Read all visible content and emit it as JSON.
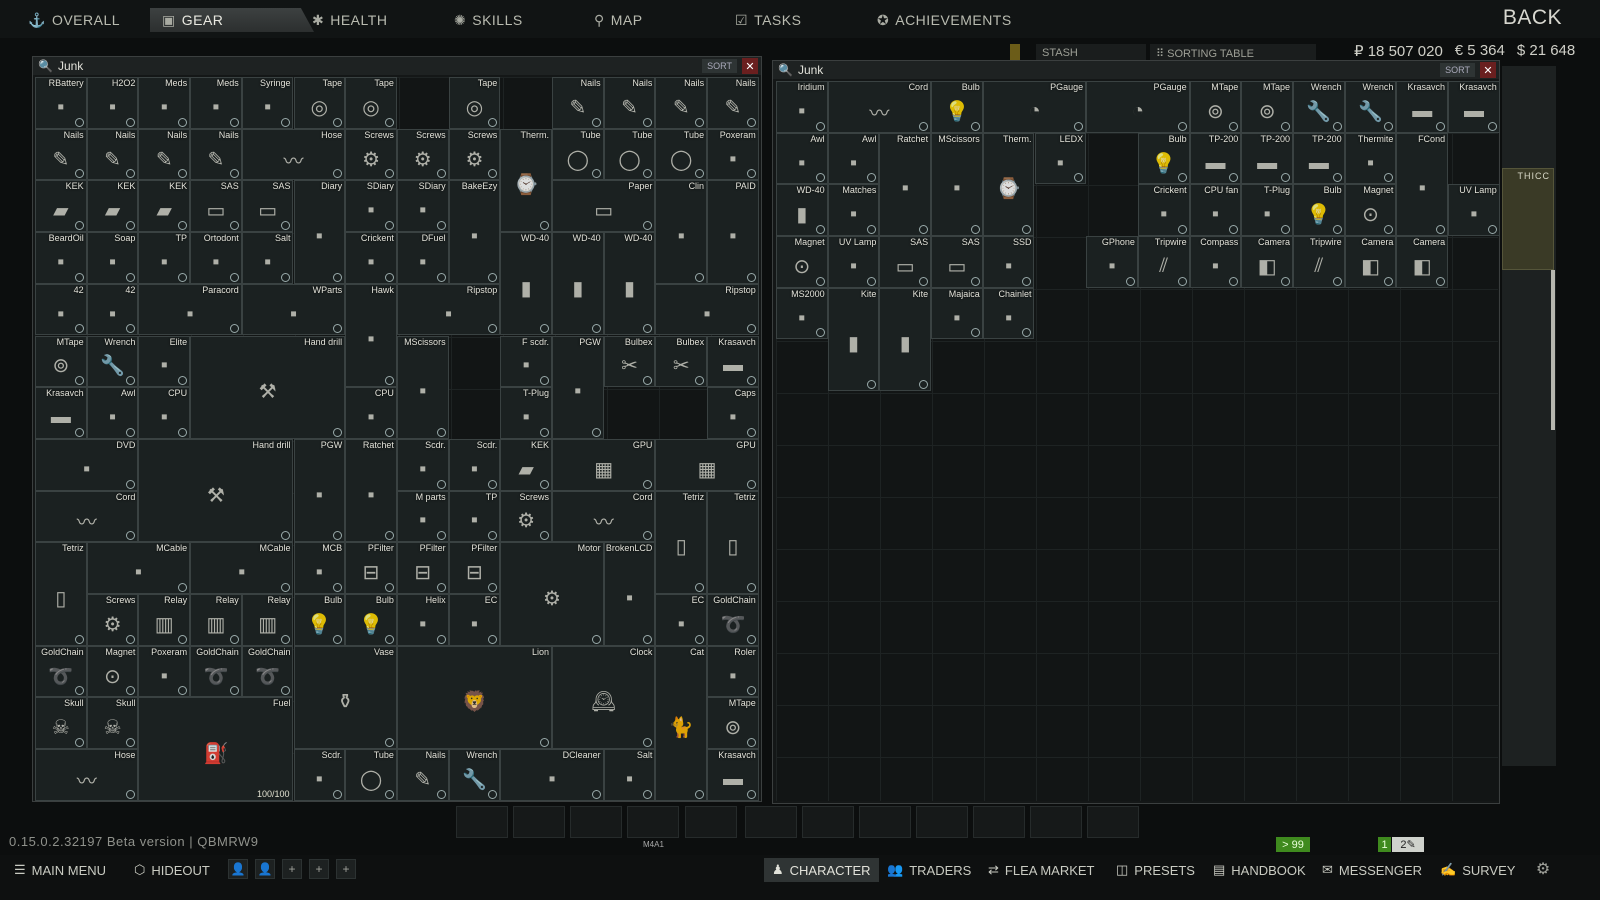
{
  "nav": {
    "tabs": [
      {
        "label": "OVERALL",
        "icon": "person-icon"
      },
      {
        "label": "GEAR",
        "icon": "vest-icon"
      },
      {
        "label": "HEALTH",
        "icon": "health-icon"
      },
      {
        "label": "SKILLS",
        "icon": "skills-icon"
      },
      {
        "label": "MAP",
        "icon": "map-pin-icon"
      },
      {
        "label": "TASKS",
        "icon": "tasks-icon"
      },
      {
        "label": "ACHIEVEMENTS",
        "icon": "achievement-icon"
      }
    ],
    "active_tab": "GEAR",
    "back_label": "BACK"
  },
  "stash_header": {
    "stash_label": "STASH",
    "sorting_table_label": "SORTING TABLE",
    "roubles": "₽ 18 507 020",
    "euros": "€ 5 364",
    "dollars": "$ 21 648"
  },
  "left_window": {
    "title": "Junk",
    "sort_label": "SORT",
    "close_label": "✕",
    "items": [
      [
        "RBattery",
        0,
        0,
        1,
        1
      ],
      [
        "H2O2",
        1,
        0,
        1,
        1
      ],
      [
        "Meds",
        2,
        0,
        1,
        1
      ],
      [
        "Meds",
        3,
        0,
        1,
        1
      ],
      [
        "Syringe",
        4,
        0,
        1,
        1
      ],
      [
        "Tape",
        5,
        0,
        1,
        1
      ],
      [
        "Tape",
        6,
        0,
        1,
        1
      ],
      [
        "Tape",
        8,
        0,
        1,
        1
      ],
      [
        "Nails",
        10,
        0,
        1,
        1
      ],
      [
        "Nails",
        11,
        0,
        1,
        1
      ],
      [
        "Nails",
        12,
        0,
        1,
        1
      ],
      [
        "Nails",
        13,
        0,
        1,
        1
      ],
      [
        "Nails",
        0,
        1,
        1,
        1
      ],
      [
        "Nails",
        1,
        1,
        1,
        1
      ],
      [
        "Nails",
        2,
        1,
        1,
        1
      ],
      [
        "Nails",
        3,
        1,
        1,
        1
      ],
      [
        "Hose",
        4,
        1,
        2,
        1
      ],
      [
        "Screws",
        6,
        1,
        1,
        1
      ],
      [
        "Screws",
        7,
        1,
        1,
        1
      ],
      [
        "Screws",
        8,
        1,
        1,
        1
      ],
      [
        "Therm.",
        9,
        1,
        1,
        2
      ],
      [
        "Tube",
        10,
        1,
        1,
        1
      ],
      [
        "Tube",
        11,
        1,
        1,
        1
      ],
      [
        "Tube",
        12,
        1,
        1,
        1
      ],
      [
        "Poxeram",
        13,
        1,
        1,
        1
      ],
      [
        "KEK",
        0,
        2,
        1,
        1
      ],
      [
        "KEK",
        1,
        2,
        1,
        1
      ],
      [
        "KEK",
        2,
        2,
        1,
        1
      ],
      [
        "SAS",
        3,
        2,
        1,
        1
      ],
      [
        "SAS",
        4,
        2,
        1,
        1
      ],
      [
        "Diary",
        5,
        2,
        1,
        2
      ],
      [
        "SDiary",
        6,
        2,
        1,
        1
      ],
      [
        "SDiary",
        7,
        2,
        1,
        1
      ],
      [
        "BakeEzy",
        8,
        2,
        1,
        2
      ],
      [
        "Paper",
        10,
        2,
        2,
        1
      ],
      [
        "Clin",
        12,
        2,
        1,
        2
      ],
      [
        "PAID",
        13,
        2,
        1,
        2
      ],
      [
        "BeardOil",
        0,
        3,
        1,
        1
      ],
      [
        "Soap",
        1,
        3,
        1,
        1
      ],
      [
        "TP",
        2,
        3,
        1,
        1
      ],
      [
        "Ortodont",
        3,
        3,
        1,
        1
      ],
      [
        "Salt",
        4,
        3,
        1,
        1
      ],
      [
        "Crickent",
        6,
        3,
        1,
        1
      ],
      [
        "DFuel",
        7,
        3,
        1,
        1
      ],
      [
        "WD-40",
        9,
        3,
        1,
        2
      ],
      [
        "WD-40",
        10,
        3,
        1,
        2
      ],
      [
        "WD-40",
        11,
        3,
        1,
        2
      ],
      [
        "42",
        0,
        4,
        1,
        1
      ],
      [
        "42",
        1,
        4,
        1,
        1
      ],
      [
        "Paracord",
        2,
        4,
        2,
        1
      ],
      [
        "WParts",
        4,
        4,
        2,
        1
      ],
      [
        "Hawk",
        6,
        4,
        1,
        2
      ],
      [
        "Ripstop",
        7,
        4,
        2,
        1
      ],
      [
        "Ripstop",
        12,
        4,
        2,
        1
      ],
      [
        "MTape",
        0,
        5,
        1,
        1
      ],
      [
        "Wrench",
        1,
        5,
        1,
        1
      ],
      [
        "Elite",
        2,
        5,
        1,
        1
      ],
      [
        "Hand drill",
        3,
        5,
        3,
        2
      ],
      [
        "MScissors",
        7,
        5,
        1,
        2
      ],
      [
        "F scdr.",
        9,
        5,
        1,
        1
      ],
      [
        "PGW",
        10,
        5,
        1,
        2
      ],
      [
        "Bulbex",
        11,
        5,
        1,
        1
      ],
      [
        "Bulbex",
        12,
        5,
        1,
        1
      ],
      [
        "Krasavch",
        13,
        5,
        1,
        1
      ],
      [
        "Krasavch",
        0,
        6,
        1,
        1
      ],
      [
        "Awl",
        1,
        6,
        1,
        1
      ],
      [
        "CPU",
        2,
        6,
        1,
        1
      ],
      [
        "CPU",
        6,
        6,
        1,
        1
      ],
      [
        "T-Plug",
        9,
        6,
        1,
        1
      ],
      [
        "Caps",
        13,
        6,
        1,
        1
      ],
      [
        "DVD",
        0,
        7,
        2,
        1
      ],
      [
        "Hand drill",
        2,
        7,
        3,
        2
      ],
      [
        "PGW",
        5,
        7,
        1,
        2
      ],
      [
        "Ratchet",
        6,
        7,
        1,
        2
      ],
      [
        "Scdr.",
        7,
        7,
        1,
        1
      ],
      [
        "Scdr.",
        8,
        7,
        1,
        1
      ],
      [
        "KEK",
        9,
        7,
        1,
        1
      ],
      [
        "GPU",
        10,
        7,
        2,
        1
      ],
      [
        "GPU",
        12,
        7,
        2,
        1
      ],
      [
        "Cord",
        0,
        8,
        2,
        1
      ],
      [
        "M parts",
        7,
        8,
        1,
        1
      ],
      [
        "TP",
        8,
        8,
        1,
        1
      ],
      [
        "Screws",
        9,
        8,
        1,
        1
      ],
      [
        "Cord",
        10,
        8,
        2,
        1
      ],
      [
        "Tetriz",
        12,
        8,
        1,
        2
      ],
      [
        "Tetriz",
        13,
        8,
        1,
        2
      ],
      [
        "Tetriz",
        0,
        9,
        1,
        2
      ],
      [
        "MCable",
        1,
        9,
        2,
        1
      ],
      [
        "MCable",
        3,
        9,
        2,
        1
      ],
      [
        "MCB",
        5,
        9,
        1,
        1
      ],
      [
        "PFilter",
        6,
        9,
        1,
        1
      ],
      [
        "PFilter",
        7,
        9,
        1,
        1
      ],
      [
        "PFilter",
        8,
        9,
        1,
        1
      ],
      [
        "Motor",
        9,
        9,
        2,
        2
      ],
      [
        "BrokenLCD",
        11,
        9,
        1,
        2
      ],
      [
        "Screws",
        1,
        10,
        1,
        1
      ],
      [
        "Relay",
        2,
        10,
        1,
        1
      ],
      [
        "Relay",
        3,
        10,
        1,
        1
      ],
      [
        "Relay",
        4,
        10,
        1,
        1
      ],
      [
        "Bulb",
        5,
        10,
        1,
        1
      ],
      [
        "Bulb",
        6,
        10,
        1,
        1
      ],
      [
        "Helix",
        7,
        10,
        1,
        1
      ],
      [
        "EC",
        8,
        10,
        1,
        1
      ],
      [
        "EC",
        12,
        10,
        1,
        1
      ],
      [
        "GoldChain",
        13,
        10,
        1,
        1
      ],
      [
        "GoldChain",
        0,
        11,
        1,
        1
      ],
      [
        "Magnet",
        1,
        11,
        1,
        1
      ],
      [
        "Poxeram",
        2,
        11,
        1,
        1
      ],
      [
        "GoldChain",
        3,
        11,
        1,
        1
      ],
      [
        "GoldChain",
        4,
        11,
        1,
        1
      ],
      [
        "Vase",
        5,
        11,
        2,
        2
      ],
      [
        "Lion",
        7,
        11,
        3,
        2
      ],
      [
        "Clock",
        10,
        11,
        2,
        2
      ],
      [
        "Cat",
        12,
        11,
        1,
        3
      ],
      [
        "Roler",
        13,
        11,
        1,
        1
      ],
      [
        "Skull",
        0,
        12,
        1,
        1
      ],
      [
        "Skull",
        1,
        12,
        1,
        1
      ],
      [
        "Fuel",
        2,
        12,
        3,
        2
      ],
      [
        "MTape",
        13,
        12,
        1,
        1
      ],
      [
        "Hose",
        0,
        13,
        2,
        1
      ],
      [
        "Scdr.",
        5,
        13,
        1,
        1
      ],
      [
        "Tube",
        6,
        13,
        1,
        1
      ],
      [
        "Nails",
        7,
        13,
        1,
        1
      ],
      [
        "Wrench",
        8,
        13,
        1,
        1
      ],
      [
        "DCleaner",
        9,
        13,
        2,
        1
      ],
      [
        "Salt",
        11,
        13,
        1,
        1
      ],
      [
        "Krasavch",
        13,
        13,
        1,
        1
      ]
    ],
    "fuel_durability": "100/100"
  },
  "right_window": {
    "title": "Junk",
    "sort_label": "SORT",
    "close_label": "✕",
    "items": [
      [
        "Iridium",
        0,
        0,
        1,
        1
      ],
      [
        "Cord",
        1,
        0,
        2,
        1
      ],
      [
        "Bulb",
        3,
        0,
        1,
        1
      ],
      [
        "PGauge",
        4,
        0,
        2,
        1
      ],
      [
        "PGauge",
        6,
        0,
        2,
        1
      ],
      [
        "MTape",
        8,
        0,
        1,
        1
      ],
      [
        "MTape",
        9,
        0,
        1,
        1
      ],
      [
        "Wrench",
        10,
        0,
        1,
        1
      ],
      [
        "Wrench",
        11,
        0,
        1,
        1
      ],
      [
        "Krasavch",
        12,
        0,
        1,
        1
      ],
      [
        "Krasavch",
        13,
        0,
        1,
        1
      ],
      [
        "Awl",
        0,
        1,
        1,
        1
      ],
      [
        "Awl",
        1,
        1,
        1,
        1
      ],
      [
        "Ratchet",
        2,
        1,
        1,
        2
      ],
      [
        "MScissors",
        3,
        1,
        1,
        2
      ],
      [
        "Therm.",
        4,
        1,
        1,
        2
      ],
      [
        "LEDX",
        5,
        1,
        1,
        1
      ],
      [
        "Bulb",
        7,
        1,
        1,
        1
      ],
      [
        "TP-200",
        8,
        1,
        1,
        1
      ],
      [
        "TP-200",
        9,
        1,
        1,
        1
      ],
      [
        "TP-200",
        10,
        1,
        1,
        1
      ],
      [
        "Thermite",
        11,
        1,
        1,
        1
      ],
      [
        "FCond",
        12,
        1,
        1,
        2
      ],
      [
        "WD-40",
        0,
        2,
        1,
        1
      ],
      [
        "Matches",
        1,
        2,
        1,
        1
      ],
      [
        "Crickent",
        7,
        2,
        1,
        1
      ],
      [
        "CPU fan",
        8,
        2,
        1,
        1
      ],
      [
        "T-Plug",
        9,
        2,
        1,
        1
      ],
      [
        "Bulb",
        10,
        2,
        1,
        1
      ],
      [
        "Magnet",
        11,
        2,
        1,
        1
      ],
      [
        "UV Lamp",
        13,
        2,
        1,
        1
      ],
      [
        "Magnet",
        0,
        3,
        1,
        1
      ],
      [
        "UV Lamp",
        1,
        3,
        1,
        1
      ],
      [
        "SAS",
        2,
        3,
        1,
        1
      ],
      [
        "SAS",
        3,
        3,
        1,
        1
      ],
      [
        "SSD",
        4,
        3,
        1,
        1
      ],
      [
        "GPhone",
        6,
        3,
        1,
        1
      ],
      [
        "Tripwire",
        7,
        3,
        1,
        1
      ],
      [
        "Compass",
        8,
        3,
        1,
        1
      ],
      [
        "Camera",
        9,
        3,
        1,
        1
      ],
      [
        "Tripwire",
        10,
        3,
        1,
        1
      ],
      [
        "Camera",
        11,
        3,
        1,
        1
      ],
      [
        "Camera",
        12,
        3,
        1,
        1
      ],
      [
        "MS2000",
        0,
        4,
        1,
        1
      ],
      [
        "Kite",
        1,
        4,
        1,
        2
      ],
      [
        "Kite",
        2,
        4,
        1,
        2
      ],
      [
        "Majaica",
        3,
        4,
        1,
        1
      ],
      [
        "Chainlet",
        4,
        4,
        1,
        1
      ]
    ]
  },
  "side_panel": {
    "item_label": "THICC"
  },
  "quickbar": {
    "weapon_label": "M4A1"
  },
  "version": "0.15.0.2.32197 Beta version | QBMRW9",
  "badges": {
    "level": "> 99",
    "slot1": "1",
    "slot2": "2"
  },
  "bottom_nav": {
    "left": [
      {
        "label": "MAIN MENU",
        "icon": "menu-icon"
      },
      {
        "label": "HIDEOUT",
        "icon": "hideout-icon"
      }
    ],
    "right": [
      {
        "label": "CHARACTER",
        "icon": "character-icon"
      },
      {
        "label": "TRADERS",
        "icon": "traders-icon"
      },
      {
        "label": "FLEA MARKET",
        "icon": "flea-icon"
      },
      {
        "label": "PRESETS",
        "icon": "presets-icon"
      },
      {
        "label": "HANDBOOK",
        "icon": "handbook-icon"
      },
      {
        "label": "MESSENGER",
        "icon": "messenger-icon"
      },
      {
        "label": "SURVEY",
        "icon": "survey-icon"
      }
    ],
    "active": "CHARACTER"
  },
  "colors": {
    "accent": "#c8a83a",
    "close": "#6a1f1f",
    "badge_green": "#3f8a1e"
  }
}
